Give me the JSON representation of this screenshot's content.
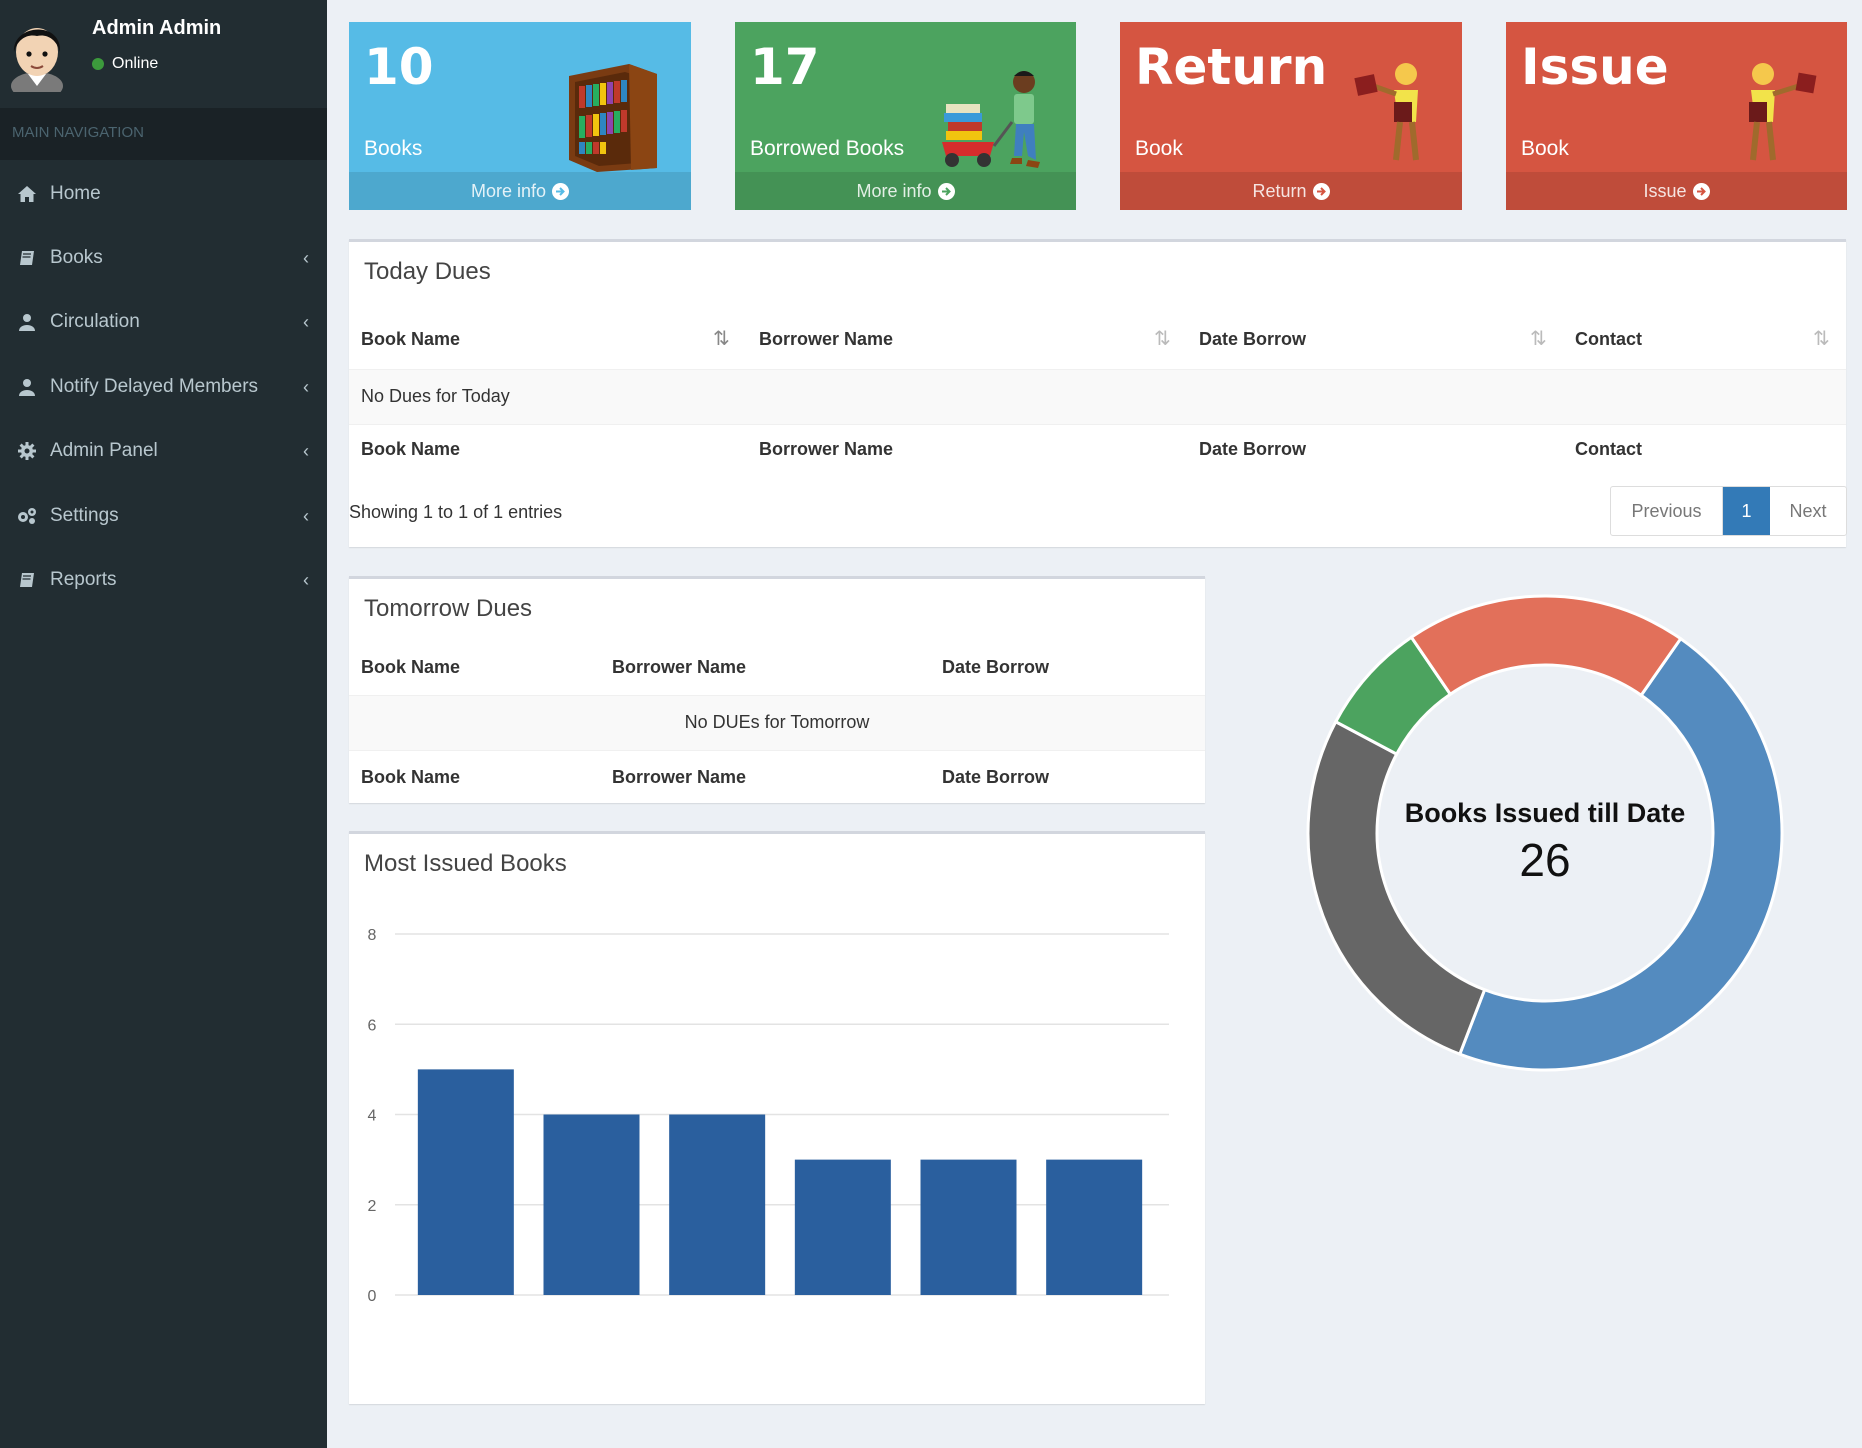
{
  "user": {
    "name": "Admin Admin",
    "status": "Online"
  },
  "nav": {
    "header": "MAIN NAVIGATION",
    "items": [
      {
        "label": "Home",
        "icon": "home-icon",
        "expandable": false
      },
      {
        "label": "Books",
        "icon": "book-icon",
        "expandable": true
      },
      {
        "label": "Circulation",
        "icon": "user-icon",
        "expandable": true
      },
      {
        "label": "Notify Delayed Members",
        "icon": "user-icon",
        "expandable": true
      },
      {
        "label": "Admin Panel",
        "icon": "gear-icon",
        "expandable": true
      },
      {
        "label": "Settings",
        "icon": "gears-icon",
        "expandable": true
      },
      {
        "label": "Reports",
        "icon": "book-icon",
        "expandable": true
      }
    ]
  },
  "cards": [
    {
      "value": "10",
      "label": "Books",
      "link": "More info",
      "color": "#56bbe6",
      "art": "bookshelf"
    },
    {
      "value": "17",
      "label": "Borrowed Books",
      "link": "More info",
      "color": "#4ca35f",
      "art": "boy-with-wagon"
    },
    {
      "value": "Return",
      "label": "Book",
      "link": "Return",
      "color": "#d55541",
      "art": "person-with-book"
    },
    {
      "value": "Issue",
      "label": "Book",
      "link": "Issue",
      "color": "#d55541",
      "art": "person-with-book"
    }
  ],
  "today_dues": {
    "title": "Today Dues",
    "columns": [
      "Book Name",
      "Borrower Name",
      "Date Borrow",
      "Contact"
    ],
    "empty_message": "No Dues for Today",
    "info": "Showing 1 to 1 of 1 entries",
    "pagination": {
      "previous": "Previous",
      "current": "1",
      "next": "Next"
    }
  },
  "tomorrow_dues": {
    "title": "Tomorrow Dues",
    "columns": [
      "Book Name",
      "Borrower Name",
      "Date Borrow"
    ],
    "empty_message": "No DUEs for Tomorrow"
  },
  "chart_data": [
    {
      "type": "bar",
      "title": "Most Issued Books",
      "categories": [
        "",
        "",
        "",
        "",
        "",
        ""
      ],
      "values": [
        5,
        4,
        4,
        3,
        3,
        3
      ],
      "ylim": [
        0,
        8
      ],
      "yticks": [
        "0",
        "2",
        "4",
        "6",
        "8"
      ],
      "grid": true,
      "color": "#2a5f9e"
    },
    {
      "type": "pie",
      "title": "Books Issued till Date",
      "total": "26",
      "values": [
        12,
        7,
        2,
        5
      ],
      "colors": [
        "#548bbf",
        "#666666",
        "#4ca35f",
        "#e2705a"
      ]
    }
  ]
}
